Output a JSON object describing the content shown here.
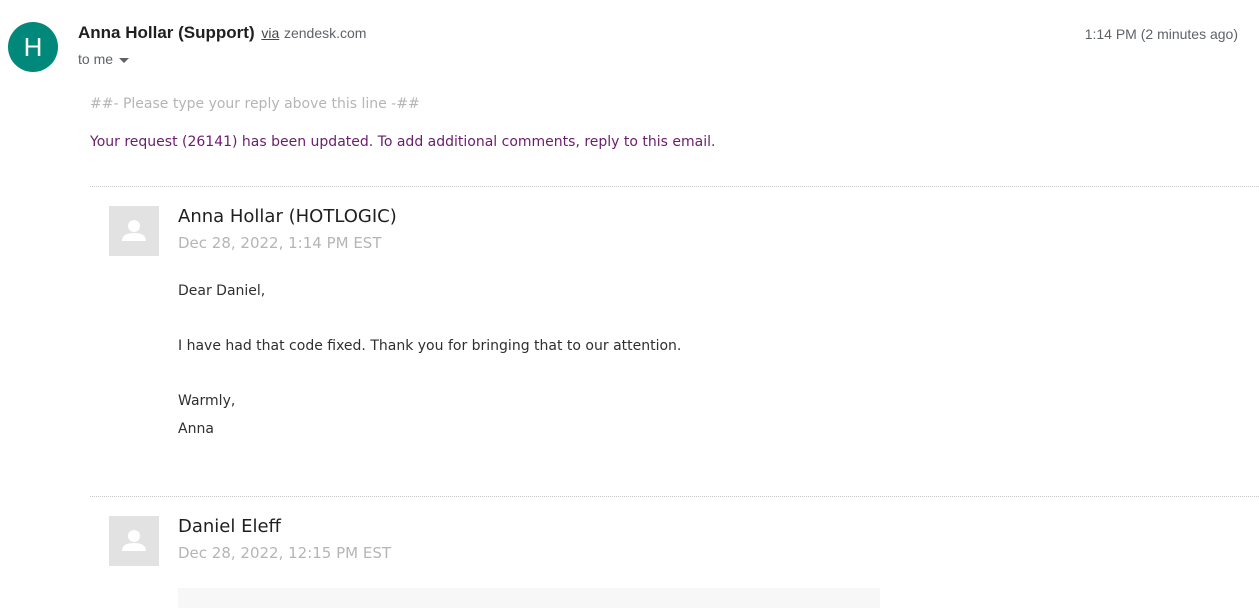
{
  "email": {
    "avatar_letter": "H",
    "avatar_color": "#00897b",
    "sender_name": "Anna Hollar (Support)",
    "via_label": "via",
    "via_domain": "zendesk.com",
    "recipient": "to me",
    "time": "1:14 PM (2 minutes ago)"
  },
  "message": {
    "reply_marker": "##- Please type your reply above this line -##",
    "request_notice": "Your request (26141) has been updated. To add additional comments, reply to this email."
  },
  "comments": [
    {
      "author": "Anna Hollar",
      "org": "(HOTLOGIC)",
      "date": "Dec 28, 2022, 1:14 PM EST",
      "lines": [
        "Dear Daniel,",
        "I have had that code fixed. Thank you for bringing that to our attention.",
        "Warmly,",
        "Anna"
      ]
    },
    {
      "author": "Daniel Eleff",
      "org": "",
      "date": "Dec 28, 2022, 12:15 PM EST",
      "lines": []
    }
  ]
}
